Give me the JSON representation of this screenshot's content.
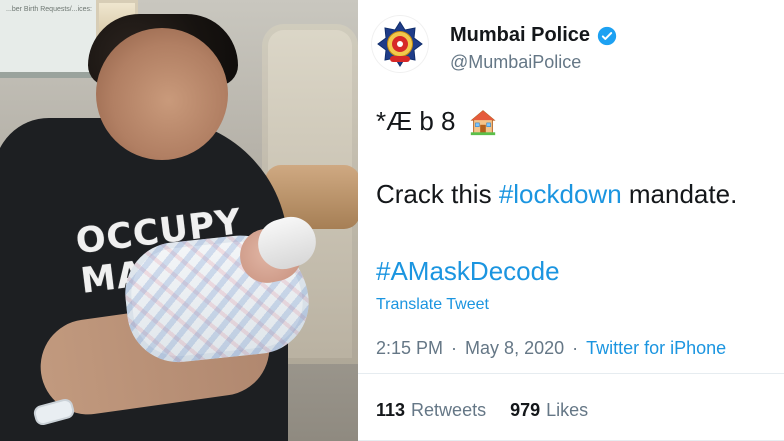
{
  "photo": {
    "wall_text": "...ber Birth Requests/...ices:",
    "shirt_line_1": "OCCUPY",
    "shirt_line_2": "MARS"
  },
  "tweet": {
    "display_name": "Mumbai Police",
    "handle": "@MumbaiPolice",
    "line1": "*Æ b 8",
    "line1_icon": "house-icon",
    "line2_prefix": "Crack this ",
    "line2_hashtag": "#lockdown",
    "line2_suffix": " mandate.",
    "line3_hashtag": "#AMaskDecode",
    "translate_label": "Translate Tweet",
    "time": "2:15 PM",
    "date": "May 8, 2020",
    "source": "Twitter for iPhone",
    "retweets_count": "113",
    "retweets_label": "Retweets",
    "likes_count": "979",
    "likes_label": "Likes"
  },
  "colors": {
    "link_blue": "#1b95e0",
    "text_dark": "#14171a",
    "text_muted": "#657786",
    "divider": "#e6ecf0",
    "shirt_black": "#1d1f22"
  }
}
